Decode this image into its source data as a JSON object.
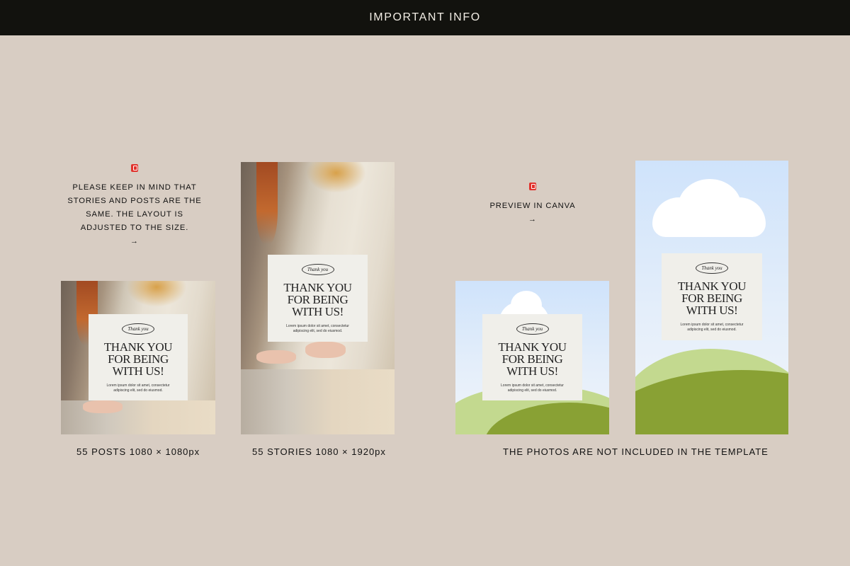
{
  "header": {
    "title": "IMPORTANT INFO"
  },
  "notes": {
    "layout_note": {
      "icon": "pin-icon",
      "lines": [
        "PLEASE KEEP IN MIND THAT",
        "STORIES AND POSTS ARE THE",
        "SAME. THE LAYOUT IS",
        "ADJUSTED TO THE SIZE."
      ],
      "arrow": "→"
    },
    "preview_note": {
      "icon": "pin-icon",
      "label": "PREVIEW IN CANVA",
      "arrow": "→"
    }
  },
  "card": {
    "badge": "Thank you",
    "headline": [
      "THANK YOU",
      "FOR BEING",
      "WITH US!"
    ],
    "body": [
      "Lorem ipsum dolor sit amet, consectetur",
      "adipiscing elit, sed do eiusmod."
    ]
  },
  "captions": {
    "posts": "55 POSTS 1080 × 1080px",
    "stories": "55 STORIES 1080 × 1920px",
    "photos_note": "THE PHOTOS ARE NOT INCLUDED IN THE TEMPLATE"
  },
  "colors": {
    "background": "#d8cdc3",
    "header_bg": "#12120e",
    "card_bg": "#f0efea",
    "pin_red": "#e1322c",
    "hill_green": "#89a134",
    "hill_light": "#c3d98f",
    "sky_blue": "#cfe3fb"
  }
}
